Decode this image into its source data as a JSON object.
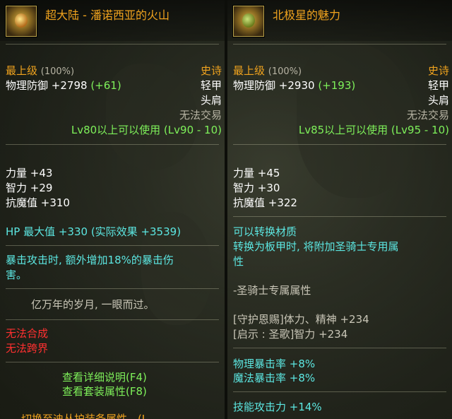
{
  "left": {
    "title": "超大陆 - 潘诺西亚的火山",
    "grade": "最上级",
    "grade_pct": "(100%)",
    "rarity": "史诗",
    "defense_label": "物理防御",
    "defense_val": "+2798",
    "defense_bonus": "(+61)",
    "armor_type": "轻甲",
    "slot": "头肩",
    "trade": "无法交易",
    "level_req": "Lv80以上可以使用 (Lv90 - 10)",
    "stats": [
      "力量 +43",
      "智力 +29",
      "抗魔值 +310"
    ],
    "hp": "HP 最大值 +330 (实际效果 +3539)",
    "crit_line1": "暴击攻击时, 额外增加18%的暴击伤",
    "crit_line2": "害。",
    "flavor": "亿万年的岁月, 一眼而过。",
    "no_craft": "无法合成",
    "no_cross": "无法跨界",
    "detail_btn": "查看详细说明(F4)",
    "set_btn": "查看套装属性(F8)",
    "cut_text": "切换至迪丛护装备属性 - (L..."
  },
  "right": {
    "title": "北极星的魅力",
    "grade": "最上级",
    "grade_pct": "(100%)",
    "rarity": "史诗",
    "defense_label": "物理防御",
    "defense_val": "+2930",
    "defense_bonus": "(+193)",
    "armor_type": "轻甲",
    "slot": "头肩",
    "trade": "无法交易",
    "level_req": "Lv85以上可以使用 (Lv95 - 10)",
    "stats": [
      "力量 +45",
      "智力 +30",
      "抗魔值 +322"
    ],
    "convert1": "可以转换材质",
    "convert2": "转换为板甲时, 将附加圣骑士专用属",
    "convert3": "性",
    "paladin": "-圣骑士专属属性",
    "bless1": "[守护恩赐]体力、精神 +234",
    "bless2": "[启示 : 圣歌]智力 +234",
    "phys_crit": "物理暴击率 +8%",
    "mag_crit": "魔法暴击率 +8%",
    "skill_atk": "技能攻击力 +14%"
  }
}
